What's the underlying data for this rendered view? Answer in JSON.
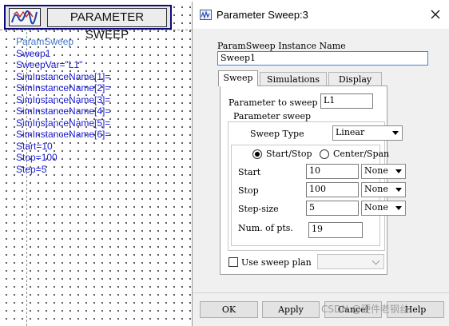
{
  "schematic": {
    "component_title": "PARAMETER SWEEP",
    "component_icon": "param-sweep-icon",
    "parameter_lines": [
      "ParamSweep",
      "Sweep1",
      "SweepVar=\"L1\"",
      "SimInstanceName[1]=",
      "SimInstanceName[2]=",
      "SimInstanceName[3]=",
      "SimInstanceName[4]=",
      "SimInstanceName[5]=",
      "SimInstanceName[6]=",
      "Start=10",
      "Stop=100",
      "Step=5"
    ]
  },
  "dialog": {
    "title": "Parameter Sweep:3",
    "title_icon": "waveform-icon",
    "close_icon": "close-icon",
    "instance_name_label": "ParamSweep Instance Name",
    "instance_name_value": "Sweep1",
    "tabs": [
      {
        "label": "Sweep",
        "active": true
      },
      {
        "label": "Simulations",
        "active": false
      },
      {
        "label": "Display",
        "active": false
      }
    ],
    "param_to_sweep_label": "Parameter to sweep",
    "param_to_sweep_value": "L1",
    "group_label": "Parameter sweep",
    "sweep_type_label": "Sweep Type",
    "sweep_type_value": "Linear",
    "radio_startstop": "Start/Stop",
    "radio_centerspan": "Center/Span",
    "radio_selected": "Start/Stop",
    "rows": [
      {
        "label": "Start",
        "value": "10",
        "unit": "None"
      },
      {
        "label": "Stop",
        "value": "100",
        "unit": "None"
      },
      {
        "label": "Step-size",
        "value": "5",
        "unit": "None"
      }
    ],
    "num_pts_label": "Num. of pts.",
    "num_pts_value": "19",
    "use_sweep_plan_label": "Use sweep plan",
    "use_sweep_plan_checked": false,
    "buttons": {
      "ok": "OK",
      "apply": "Apply",
      "cancel": "Cancel",
      "help": "Help"
    }
  },
  "watermark": "CSDN @硬件老钢丝",
  "colors": {
    "param_text": "#1b1bd6",
    "frame": "#0a0a7a",
    "focus": "#3d86d8"
  }
}
